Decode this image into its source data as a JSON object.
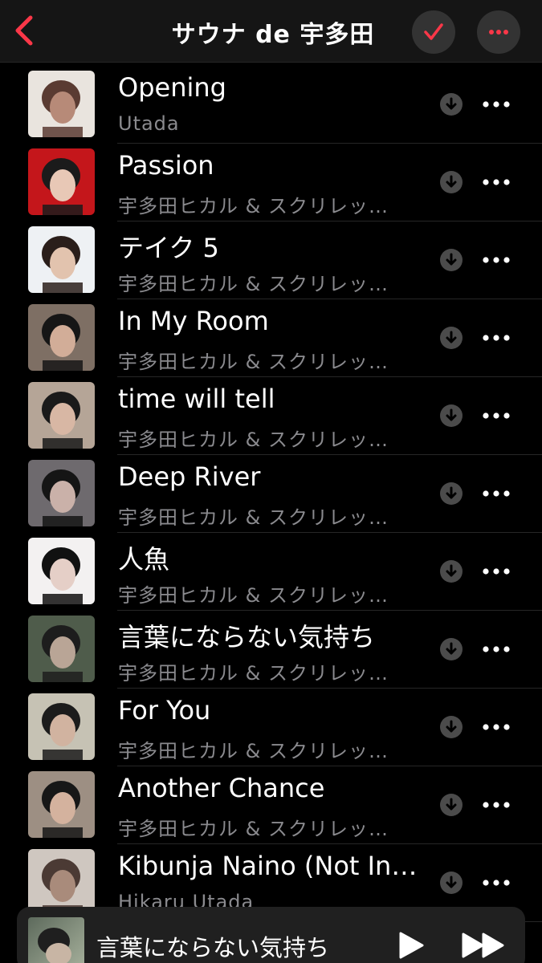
{
  "header": {
    "title": "サウナ de 宇多田",
    "back_icon": "chevron-left-icon",
    "check_icon": "checkmark-icon",
    "more_icon": "ellipsis-icon"
  },
  "colors": {
    "accent": "#fa3748",
    "background": "#000000",
    "header_bg": "#151515",
    "button_bg": "#333333",
    "secondary_text": "#8a8a8e",
    "divider": "#262626"
  },
  "tracks": [
    {
      "title": "Opening",
      "artist": "Utada"
    },
    {
      "title": "Passion",
      "artist": "宇多田ヒカル & スクリレッ…"
    },
    {
      "title": "テイク 5",
      "artist": "宇多田ヒカル & スクリレッ…"
    },
    {
      "title": "In My Room",
      "artist": "宇多田ヒカル & スクリレッ…"
    },
    {
      "title": "time will tell",
      "artist": "宇多田ヒカル & スクリレッ…"
    },
    {
      "title": "Deep River",
      "artist": "宇多田ヒカル & スクリレッ…"
    },
    {
      "title": "人魚",
      "artist": "宇多田ヒカル & スクリレッ…"
    },
    {
      "title": "言葉にならない気持ち",
      "artist": "宇多田ヒカル & スクリレッ…"
    },
    {
      "title": "For You",
      "artist": "宇多田ヒカル & スクリレッ…"
    },
    {
      "title": "Another Chance",
      "artist": "宇多田ヒカル & スクリレッ…"
    },
    {
      "title": "Kibunja Naino (Not In…",
      "artist": "Hikaru Utada"
    }
  ],
  "row_icons": {
    "download": "download-icon",
    "more": "ellipsis-icon"
  },
  "mini_player": {
    "title": "言葉にならない気持ち",
    "play_icon": "play-icon",
    "forward_icon": "fast-forward-icon"
  }
}
